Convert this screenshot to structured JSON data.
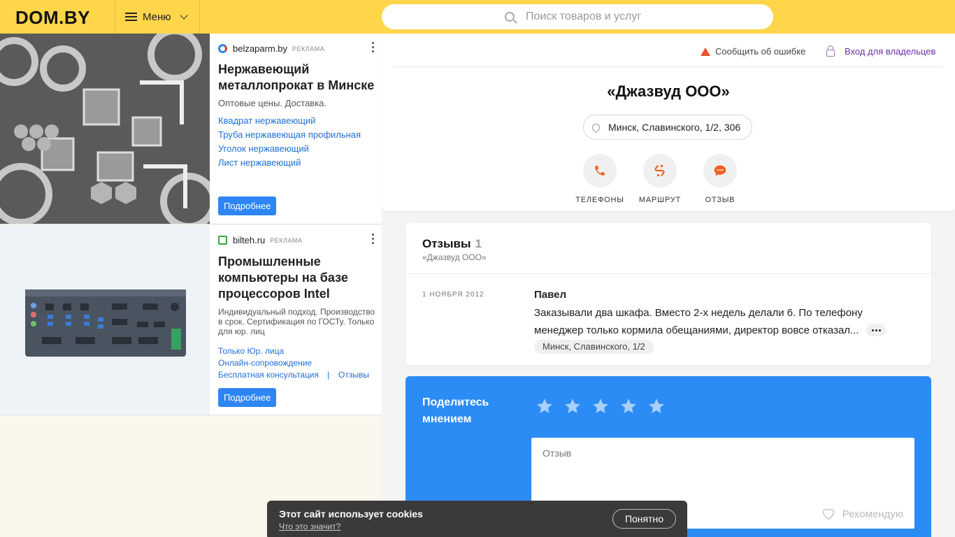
{
  "header": {
    "logo": "DOM.BY",
    "menu_label": "Меню",
    "search_placeholder": "Поиск товаров и услуг"
  },
  "ads": [
    {
      "source": "belzaparm.by",
      "tag": "РЕКЛАМА",
      "title": "Нержавеющий металлопрокат в Минске",
      "description": "Оптовые цены. Доставка.",
      "links": [
        "Квадрат нержавеющий",
        "Труба нержавеющая профильная",
        "Уголок нержавеющий",
        "Лист нержавеющий"
      ],
      "button": "Подробнее"
    },
    {
      "source": "bilteh.ru",
      "tag": "РЕКЛАМА",
      "title": "Промышленные компьютеры на базе процессоров Intel",
      "description": "Индивидуальный подход. Производство в срок. Сертификация по ГОСТу. Только для юр. лиц",
      "links": [
        "Только Юр. лица",
        "Онлайн-сопровождение",
        "Бесплатная консультация",
        "|",
        "Отзывы"
      ],
      "button": "Подробнее"
    }
  ],
  "company": {
    "report_error": "Сообщить об ошибке",
    "owner_login": "Вход для владельцев",
    "title": "«Джазвуд ООО»",
    "address": "Минск, Славинского, 1/2, 306",
    "actions": [
      "ТЕЛЕФОНЫ",
      "МАРШРУТ",
      "ОТЗЫВ"
    ]
  },
  "reviews": {
    "title": "Отзывы",
    "count": "1",
    "subtitle": "«Джазвуд ООО»",
    "items": [
      {
        "date": "1 НОЯБРЯ 2012",
        "author": "Павел",
        "text": "Заказывали два шкафа. Вместо 2-х недель делали 6. По телефону менеджер только кормила обещаниями, директор вовсе отказал...",
        "location": "Минск, Славинского, 1/2"
      }
    ]
  },
  "share": {
    "title": "Поделитесь мнением",
    "rating": 0,
    "max_rating": 5,
    "review_placeholder": "Отзыв",
    "recommend": "Рекомендую"
  },
  "cookie": {
    "text": "Этот сайт использует cookies",
    "link": "Что это значит?",
    "button": "Понятно"
  },
  "colors": {
    "header_bg": "#ffd54a",
    "accent_blue": "#2b8cf5",
    "action_orange": "#f0601c",
    "link": "#1f6fd6"
  }
}
